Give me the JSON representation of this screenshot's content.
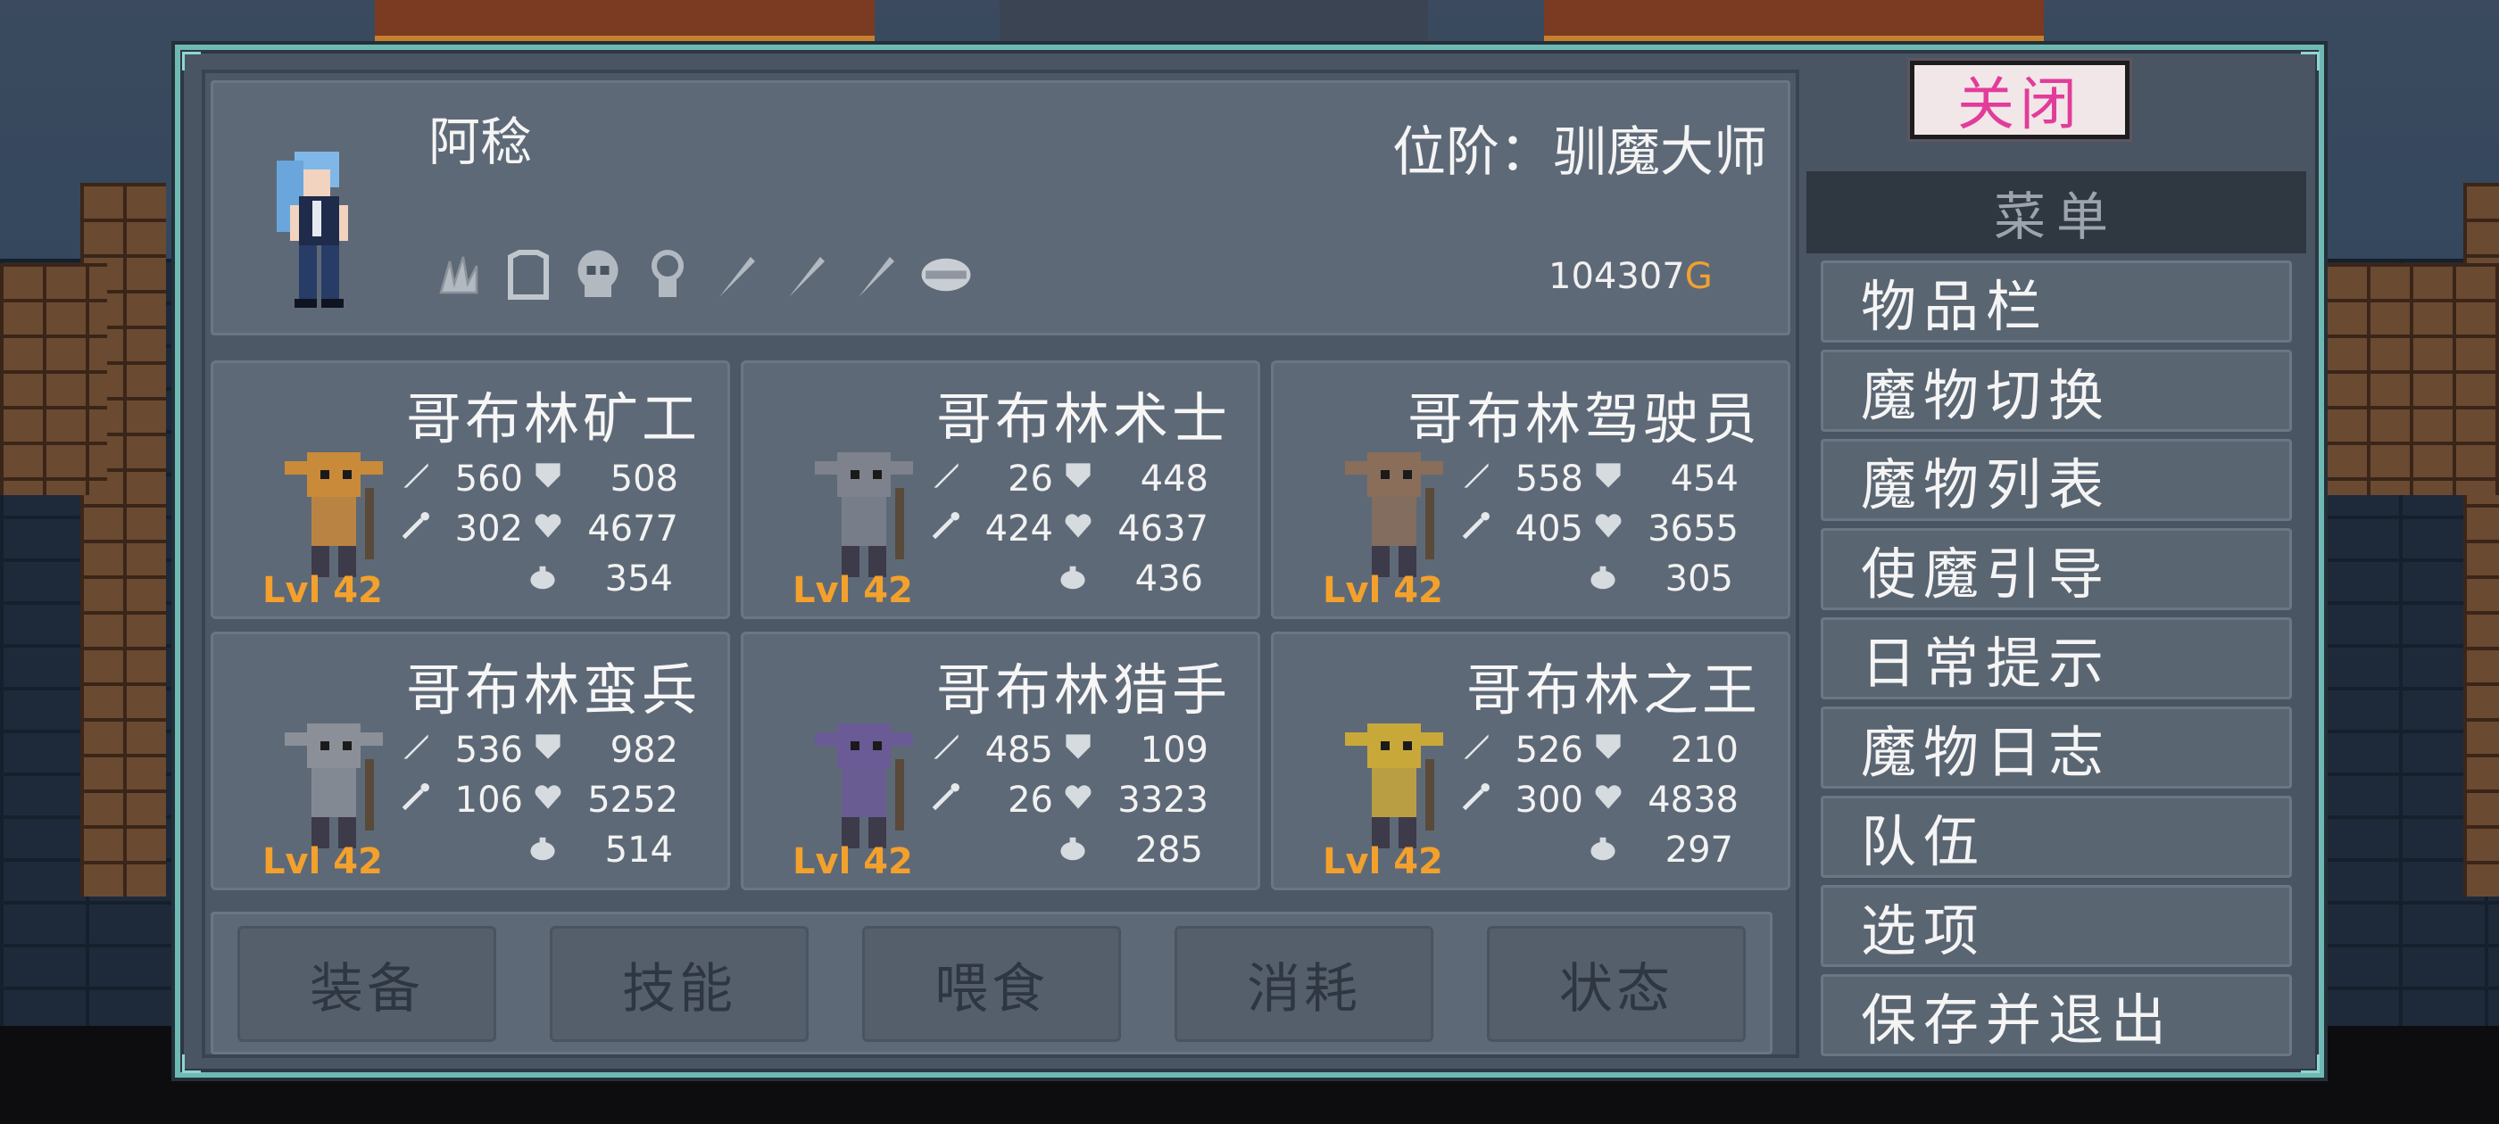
{
  "trainer": {
    "name": "阿稔",
    "rank": "位阶：驯魔大师",
    "gold_value": "104307",
    "gold_suffix": "G"
  },
  "equipment_slots": [
    {
      "icon": "claw-icon"
    },
    {
      "icon": "armor-icon"
    },
    {
      "icon": "skull-helm-icon"
    },
    {
      "icon": "amulet-icon"
    },
    {
      "icon": "feather-icon"
    },
    {
      "icon": "feather-icon"
    },
    {
      "icon": "feather-icon"
    },
    {
      "icon": "saddle-icon"
    }
  ],
  "monsters": [
    {
      "name": "哥布林矿工",
      "level": "Lvl 42",
      "attack": "560",
      "defense": "508",
      "magic": "302",
      "hp": "4677",
      "speed": "354"
    },
    {
      "name": "哥布林术士",
      "level": "Lvl 42",
      "attack": "26",
      "defense": "448",
      "magic": "424",
      "hp": "4637",
      "speed": "436"
    },
    {
      "name": "哥布林驾驶员",
      "level": "Lvl 42",
      "attack": "558",
      "defense": "454",
      "magic": "405",
      "hp": "3655",
      "speed": "305"
    },
    {
      "name": "哥布林蛮兵",
      "level": "Lvl 42",
      "attack": "536",
      "defense": "982",
      "magic": "106",
      "hp": "5252",
      "speed": "514"
    },
    {
      "name": "哥布林猎手",
      "level": "Lvl 42",
      "attack": "485",
      "defense": "109",
      "magic": "26",
      "hp": "3323",
      "speed": "285"
    },
    {
      "name": "哥布林之王",
      "level": "Lvl 42",
      "attack": "526",
      "defense": "210",
      "magic": "300",
      "hp": "4838",
      "speed": "297"
    }
  ],
  "tabs": [
    "装备",
    "技能",
    "喂食",
    "消耗",
    "状态"
  ],
  "menu": {
    "close_label": "关闭",
    "title": "菜单",
    "items": [
      "物品栏",
      "魔物切换",
      "魔物列表",
      "使魔引导",
      "日常提示",
      "魔物日志",
      "队伍",
      "选项",
      "保存并退出"
    ]
  },
  "colors": {
    "frame_border": "#6fb9b4",
    "panel": "#5e6977",
    "level_orange": "#f3a12c",
    "close_text": "#e23c9a",
    "gold": "#f2a12f"
  }
}
